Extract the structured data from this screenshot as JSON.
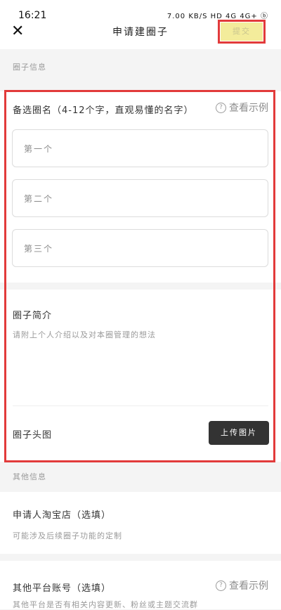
{
  "status_bar": {
    "time": "16:21",
    "indicators": "7.00 KB/S  HD  4G  4G+  ⓑ"
  },
  "nav": {
    "close_icon": "close-icon",
    "title": "申请建圈子",
    "submit_label": "提交"
  },
  "circle_info": {
    "section_label": "圈子信息",
    "name_title": "备选圈名（4-12个字，直观易懂的名字）",
    "example_label": "查看示例",
    "inputs": [
      {
        "placeholder": "第一个"
      },
      {
        "placeholder": "第二个"
      },
      {
        "placeholder": "第三个"
      }
    ],
    "intro_title": "圈子简介",
    "intro_placeholder": "请附上个人介绍以及对本圈管理的想法",
    "avatar_title": "圈子头图",
    "upload_label": "上传图片"
  },
  "other_info": {
    "section_label": "其他信息",
    "shop_title": "申请人淘宝店（选填）",
    "shop_desc": "可能涉及后续圈子功能的定制",
    "platform_title": "其他平台账号（选填）",
    "platform_example_label": "查看示例",
    "platform_desc": "其他平台是否有相关内容更新、粉丝或主题交流群"
  },
  "colors": {
    "highlight": "#e23b3b",
    "submit_bg": "#f3ec9b",
    "upload_bg": "#333333"
  }
}
